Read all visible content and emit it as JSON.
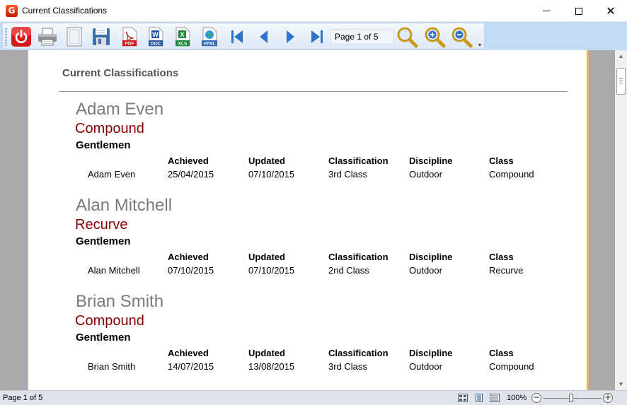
{
  "window": {
    "title": "Current Classifications",
    "app_icon_letter": "G"
  },
  "toolbar": {
    "page_indicator": "Page 1 of 5",
    "icons": [
      "power-icon",
      "print-icon",
      "page-setup-icon",
      "save-icon",
      "pdf-icon",
      "doc-icon",
      "xls-icon",
      "html-icon",
      "first-page-icon",
      "previous-page-icon",
      "next-page-icon",
      "last-page-icon",
      "zoom-icon",
      "zoom-in-icon",
      "zoom-out-icon"
    ],
    "pdf_label": "PDF",
    "doc_label": "DOC",
    "xls_label": "XLS",
    "html_label": "HTML"
  },
  "report": {
    "title": "Current Classifications",
    "headers": {
      "achieved": "Achieved",
      "updated": "Updated",
      "classification": "Classification",
      "discipline": "Discipline",
      "class": "Class"
    },
    "people": [
      {
        "name": "Adam Even",
        "bow": "Compound",
        "group": "Gentlemen",
        "row": {
          "name": "Adam Even",
          "achieved": "25/04/2015",
          "updated": "07/10/2015",
          "classification": "3rd Class",
          "discipline": "Outdoor",
          "class": "Compound"
        }
      },
      {
        "name": "Alan Mitchell",
        "bow": "Recurve",
        "group": "Gentlemen",
        "row": {
          "name": "Alan Mitchell",
          "achieved": "07/10/2015",
          "updated": "07/10/2015",
          "classification": "2nd Class",
          "discipline": "Outdoor",
          "class": "Recurve"
        }
      },
      {
        "name": "Brian Smith",
        "bow": "Compound",
        "group": "Gentlemen",
        "row": {
          "name": "Brian Smith",
          "achieved": "14/07/2015",
          "updated": "13/08/2015",
          "classification": "3rd Class",
          "discipline": "Outdoor",
          "class": "Compound"
        }
      }
    ]
  },
  "statusbar": {
    "page_text": "Page 1 of 5",
    "zoom": "100%"
  },
  "colors": {
    "toolbar_strip": "#c4dbf5",
    "viewport_bg": "#a9a9a9",
    "paper_border": "#e2b857",
    "bow_type": "#8b0000",
    "person_name": "#7a7a7a"
  }
}
